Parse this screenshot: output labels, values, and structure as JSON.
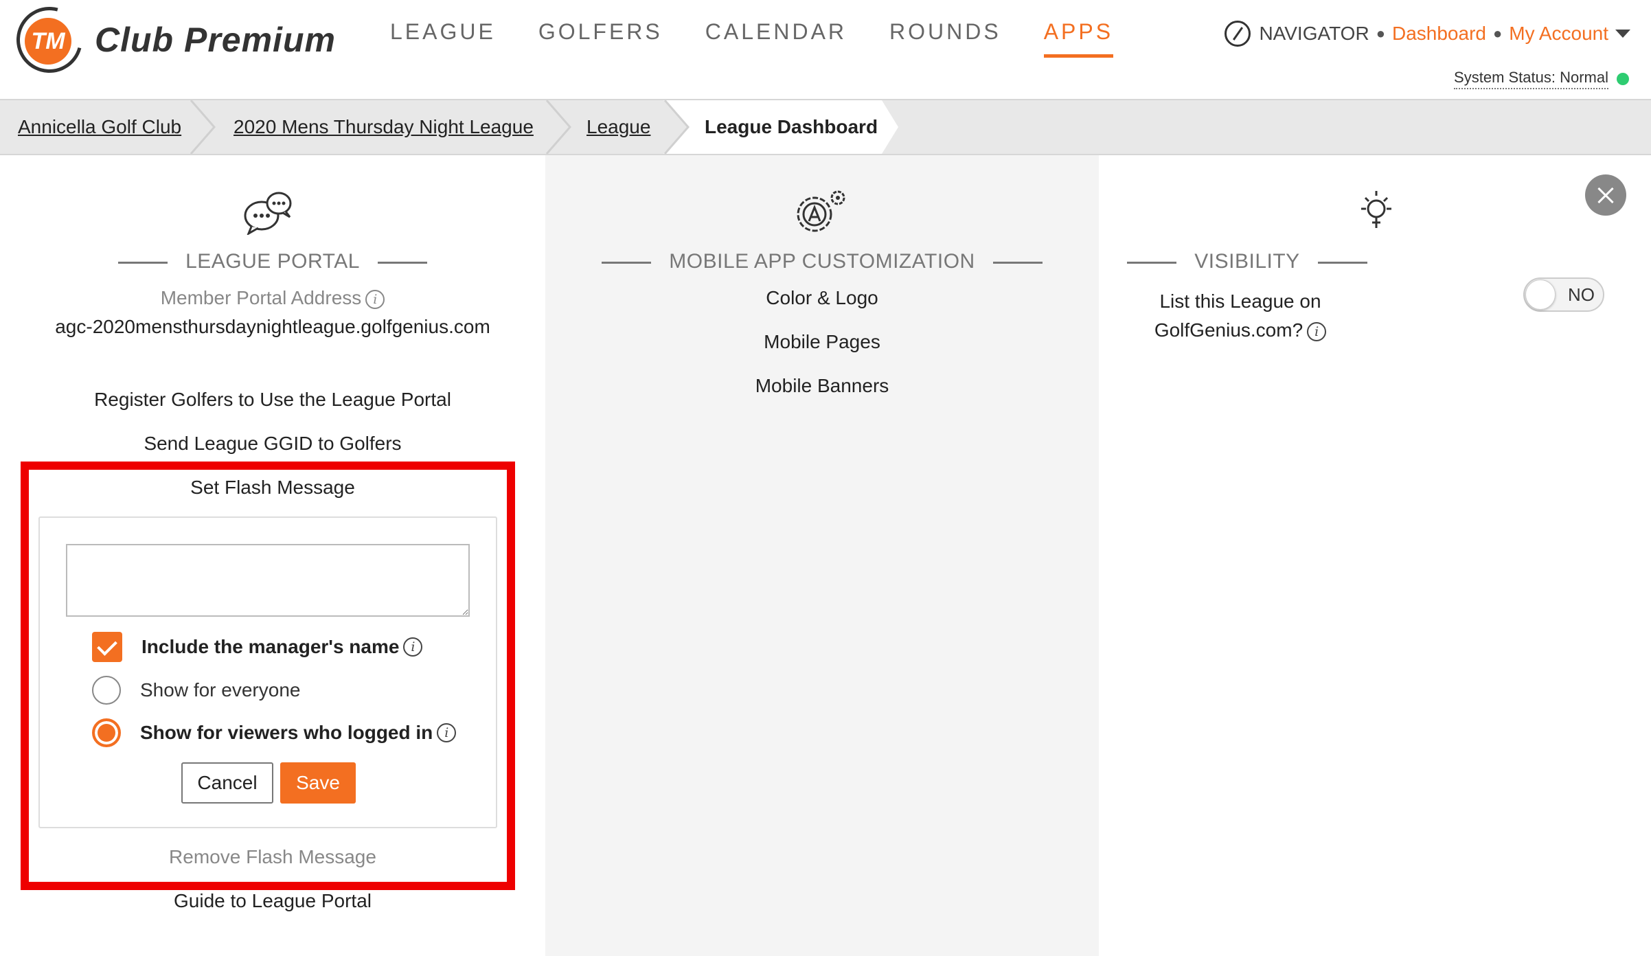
{
  "header": {
    "logo_badge": "TM",
    "logo_text": "Club Premium",
    "nav": [
      {
        "label": "LEAGUE"
      },
      {
        "label": "GOLFERS"
      },
      {
        "label": "CALENDAR"
      },
      {
        "label": "ROUNDS"
      },
      {
        "label": "APPS"
      }
    ],
    "active_nav": "APPS",
    "navigator_label": "NAVIGATOR",
    "dashboard_link": "Dashboard",
    "account_link": "My Account",
    "system_status": "System Status: Normal",
    "status_color": "#2ecc71",
    "accent_color": "#f36f21"
  },
  "breadcrumb": [
    {
      "label": "Annicella Golf Club"
    },
    {
      "label": "2020 Mens Thursday Night League"
    },
    {
      "label": "League"
    },
    {
      "label": "League Dashboard"
    }
  ],
  "league_portal": {
    "icon": "chat-bubbles-icon",
    "title": "LEAGUE PORTAL",
    "address_label": "Member Portal Address",
    "address": "agc-2020mensthursdaynightleague.golfgenius.com",
    "links": {
      "register": "Register Golfers to Use the League Portal",
      "send_ggid": "Send League GGID to Golfers",
      "set_flash": "Set Flash Message",
      "remove_flash": "Remove Flash Message",
      "guide": "Guide to League Portal"
    },
    "flash": {
      "message_value": "",
      "include_manager_label": "Include the manager's name",
      "include_manager_checked": true,
      "show_everyone_label": "Show for everyone",
      "show_logged_in_label": "Show for viewers who logged in",
      "selected_visibility": "logged_in",
      "cancel_label": "Cancel",
      "save_label": "Save"
    },
    "info_glyph": "i"
  },
  "mobile_app": {
    "icon": "app-gear-icon",
    "title": "MOBILE APP CUSTOMIZATION",
    "links": [
      "Color & Logo",
      "Mobile Pages",
      "Mobile Banners"
    ]
  },
  "visibility": {
    "icon": "lightbulb-icon",
    "title": "VISIBILITY",
    "question_line1": "List this League on",
    "question_line2": "GolfGenius.com?",
    "toggle_value": "NO"
  }
}
